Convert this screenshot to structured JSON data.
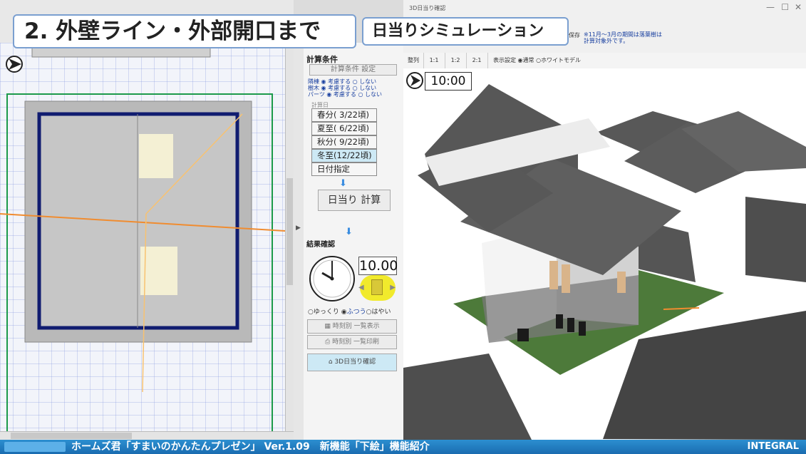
{
  "overlay": {
    "main_title": "2. 外壁ライン・外部開口まで",
    "sub_title": "日当りシミュレーション"
  },
  "window_3d": {
    "title": "3D日当り確認",
    "note_line1": "※11月〜3月の期間は落葉樹は",
    "note_line2": "計算対象外です。",
    "save_label": "保存",
    "tabs": [
      "整列",
      "1:1",
      "1:2",
      "2:1"
    ],
    "display_setting_label": "表示設定",
    "radio_normal": "通常",
    "radio_white": "ホワイトモデル",
    "time_display": "10:00"
  },
  "panel": {
    "calc_conditions_title": "計算条件",
    "calc_settings_button": "計算条件 設定",
    "options": [
      {
        "label": "隣棟",
        "on": "考慮する",
        "off": "しない"
      },
      {
        "label": "樹木",
        "on": "考慮する",
        "off": "しない"
      },
      {
        "label": "パーツ",
        "on": "考慮する",
        "off": "しない"
      }
    ],
    "calc_day_label": "計算日",
    "days": [
      "春分( 3/22頃)",
      "夏至( 6/22頃)",
      "秋分( 9/22頃)",
      "冬至(12/22頃)",
      "日付指定"
    ],
    "selected_day": 3,
    "calc_button": "日当り 計算",
    "result_title": "結果確認",
    "time_value": "10.00",
    "speed": {
      "slow": "ゆっくり",
      "normal": "ふつう",
      "fast": "はやい"
    },
    "list_display": "時刻別 一覧表示",
    "list_print": "時刻別 一覧印刷",
    "check_3d": "3D日当り確認"
  },
  "banner": {
    "text": "ホームズ君「すまいのかんたんプレゼン」 Ver.1.09　新機能「下絵」機能紹介",
    "logo": "INTEGRAL"
  },
  "colors": {
    "accent": "#1a6cb0",
    "selected_day": "#cde9f5",
    "sun_line": "#f08c30"
  }
}
